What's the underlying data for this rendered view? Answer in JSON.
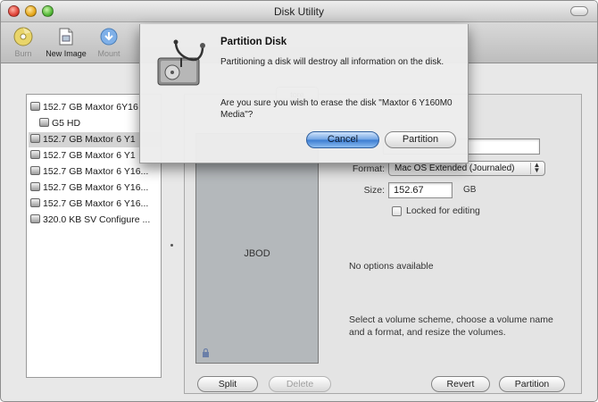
{
  "window": {
    "title": "Disk Utility"
  },
  "toolbar": {
    "items": [
      {
        "label": "Burn",
        "icon": "burn-icon",
        "enabled": false
      },
      {
        "label": "New Image",
        "icon": "new-image-icon",
        "enabled": true
      },
      {
        "label": "Mount",
        "icon": "mount-icon",
        "enabled": false
      }
    ]
  },
  "sidebar": {
    "items": [
      {
        "label": "152.7 GB Maxtor 6Y16",
        "type": "disk"
      },
      {
        "label": "G5 HD",
        "type": "volume"
      },
      {
        "label": "152.7 GB Maxtor 6 Y1",
        "type": "disk",
        "selected": true
      },
      {
        "label": "152.7 GB Maxtor 6 Y1",
        "type": "disk"
      },
      {
        "label": "152.7 GB Maxtor 6 Y16...",
        "type": "disk"
      },
      {
        "label": "152.7 GB Maxtor 6 Y16...",
        "type": "disk"
      },
      {
        "label": "152.7 GB Maxtor 6 Y16...",
        "type": "disk"
      },
      {
        "label": "320.0 KB SV Configure ...",
        "type": "disk"
      }
    ]
  },
  "tabs": {
    "restore_label": "tore"
  },
  "partition_pane": {
    "volume_name": "JBOD",
    "format_label": "Format:",
    "format_value": "Mac OS Extended (Journaled)",
    "size_label": "Size:",
    "size_value": "152.67",
    "size_unit": "GB",
    "locked_label": "Locked for editing",
    "locked_checked": false,
    "no_options": "No options available",
    "instructions": "Select a volume scheme, choose a volume name and a format, and resize the volumes.",
    "split_label": "Split",
    "delete_label": "Delete",
    "revert_label": "Revert",
    "partition_label": "Partition"
  },
  "dialog": {
    "title": "Partition Disk",
    "warning": "Partitioning a disk will destroy all information on the disk.",
    "question": "Are you sure you wish to erase the disk \"Maxtor 6 Y160M0 Media\"?",
    "cancel_label": "Cancel",
    "partition_label": "Partition"
  },
  "colors": {
    "default_button": "#3a7bd1",
    "selection": "#d4d4d4"
  }
}
